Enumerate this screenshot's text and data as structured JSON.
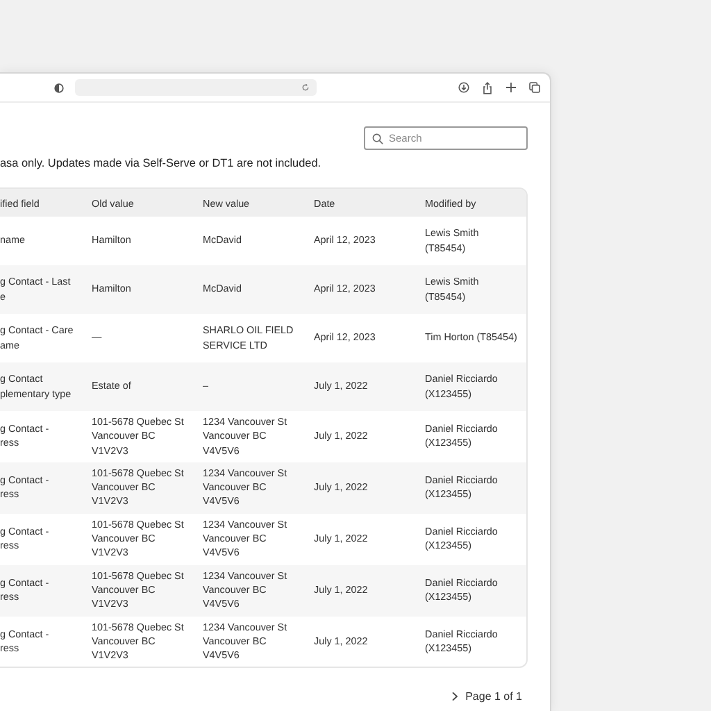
{
  "search": {
    "placeholder": "Search"
  },
  "note": "asa only. Updates made via Self-Serve or DT1 are not included.",
  "table": {
    "columns": [
      "ified field",
      "Old value",
      "New value",
      "Date",
      "Modified by"
    ],
    "rows": [
      [
        "name",
        "Hamilton",
        "McDavid",
        "April 12, 2023",
        "Lewis Smith\n(T85454)"
      ],
      [
        "g Contact - Last\ne",
        "Hamilton",
        "McDavid",
        "April 12, 2023",
        "Lewis Smith\n(T85454)"
      ],
      [
        "g Contact - Care\name",
        "—",
        "SHARLO OIL FIELD\nSERVICE LTD",
        "April 12, 2023",
        "Tim Horton (T85454)"
      ],
      [
        "g Contact\nplementary type",
        "Estate of",
        "–",
        "July 1, 2022",
        "Daniel Ricciardo\n(X123455)"
      ],
      [
        "g Contact -\nress",
        "101-5678 Quebec St\nVancouver BC\nV1V2V3",
        "1234 Vancouver St\nVancouver BC\nV4V5V6",
        "July 1, 2022",
        "Daniel Ricciardo\n(X123455)"
      ],
      [
        "g Contact -\nress",
        "101-5678 Quebec St\nVancouver BC\nV1V2V3",
        "1234 Vancouver St\nVancouver BC\nV4V5V6",
        "July 1, 2022",
        "Daniel Ricciardo\n(X123455)"
      ],
      [
        "g Contact -\nress",
        "101-5678 Quebec St\nVancouver BC\nV1V2V3",
        "1234 Vancouver St\nVancouver BC\nV4V5V6",
        "July 1, 2022",
        "Daniel Ricciardo\n(X123455)"
      ],
      [
        "g Contact -\nress",
        "101-5678 Quebec St\nVancouver BC\nV1V2V3",
        "1234 Vancouver St\nVancouver BC\nV4V5V6",
        "July 1, 2022",
        "Daniel Ricciardo\n(X123455)"
      ],
      [
        "g Contact -\nress",
        "101-5678 Quebec St\nVancouver BC\nV1V2V3",
        "1234 Vancouver St\nVancouver BC\nV4V5V6",
        "July 1, 2022",
        "Daniel Ricciardo\n(X123455)"
      ]
    ]
  },
  "pager": "Page 1 of 1"
}
